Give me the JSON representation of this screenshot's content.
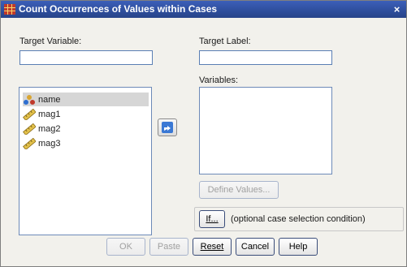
{
  "window": {
    "title": "Count Occurrences of Values within Cases",
    "close_symbol": "×"
  },
  "target_variable": {
    "label": "Target Variable:",
    "value": ""
  },
  "target_label": {
    "label": "Target Label:",
    "value": ""
  },
  "variables": {
    "label": "Variables:",
    "items": []
  },
  "source_list": {
    "items": [
      {
        "label": "name",
        "icon": "nominal-variable-icon",
        "selected": true
      },
      {
        "label": "mag1",
        "icon": "scale-ruler-icon",
        "selected": false
      },
      {
        "label": "mag2",
        "icon": "scale-ruler-icon",
        "selected": false
      },
      {
        "label": "mag3",
        "icon": "scale-ruler-icon",
        "selected": false
      }
    ]
  },
  "buttons": {
    "define_values": "Define Values...",
    "if": "If...",
    "if_description": "(optional case selection condition)",
    "ok": "OK",
    "paste": "Paste",
    "reset": "Reset",
    "cancel": "Cancel",
    "help": "Help"
  },
  "colors": {
    "title_bar": "#2f4f9e",
    "dialog_bg": "#f2f1ec",
    "accent_blue": "#3a78d4"
  }
}
